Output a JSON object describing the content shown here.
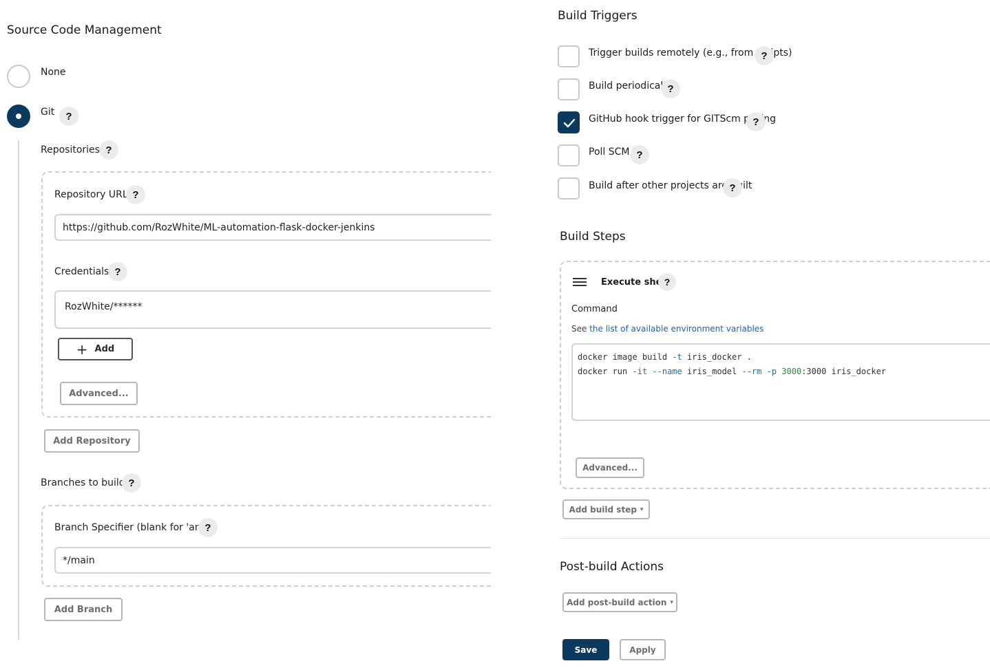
{
  "scm": {
    "title": "Source Code Management",
    "options": [
      {
        "label": "None",
        "selected": false
      },
      {
        "label": "Git",
        "selected": true
      }
    ],
    "repositories_label": "Repositories",
    "repo_url_label": "Repository URL",
    "repo_url_value": "https://github.com/RozWhite/ML-automation-flask-docker-jenkins",
    "credentials_label": "Credentials",
    "credentials_value": "RozWhite/******",
    "add_label": "Add",
    "advanced_label": "Advanced...",
    "add_repository_label": "Add Repository",
    "branches_label": "Branches to build",
    "branch_specifier_label": "Branch Specifier (blank for 'any')",
    "branch_specifier_value": "*/main",
    "add_branch_label": "Add Branch"
  },
  "triggers": {
    "title": "Build Triggers",
    "items": [
      {
        "label": "Trigger builds remotely (e.g., from scripts)",
        "checked": false
      },
      {
        "label": "Build periodically",
        "checked": false
      },
      {
        "label": "GitHub hook trigger for GITScm polling",
        "checked": true
      },
      {
        "label": "Poll SCM",
        "checked": false
      },
      {
        "label": "Build after other projects are built",
        "checked": false
      }
    ]
  },
  "build_steps": {
    "title": "Build Steps",
    "step_title": "Execute shell",
    "command_label": "Command",
    "see_prefix": "See",
    "env_link": "the list of available environment variables",
    "command_lines": [
      "docker image build -t iris_docker .",
      "docker run -it --name iris_model --rm -p 3000:3000 iris_docker"
    ],
    "advanced_label": "Advanced...",
    "add_step_label": "Add build step"
  },
  "post_build": {
    "title": "Post-build Actions",
    "add_action_label": "Add post-build action"
  },
  "footer": {
    "save_label": "Save",
    "apply_label": "Apply"
  },
  "help_glyph": "?",
  "colors": {
    "primary": "#0b3a5e",
    "link": "#1a63b5"
  }
}
